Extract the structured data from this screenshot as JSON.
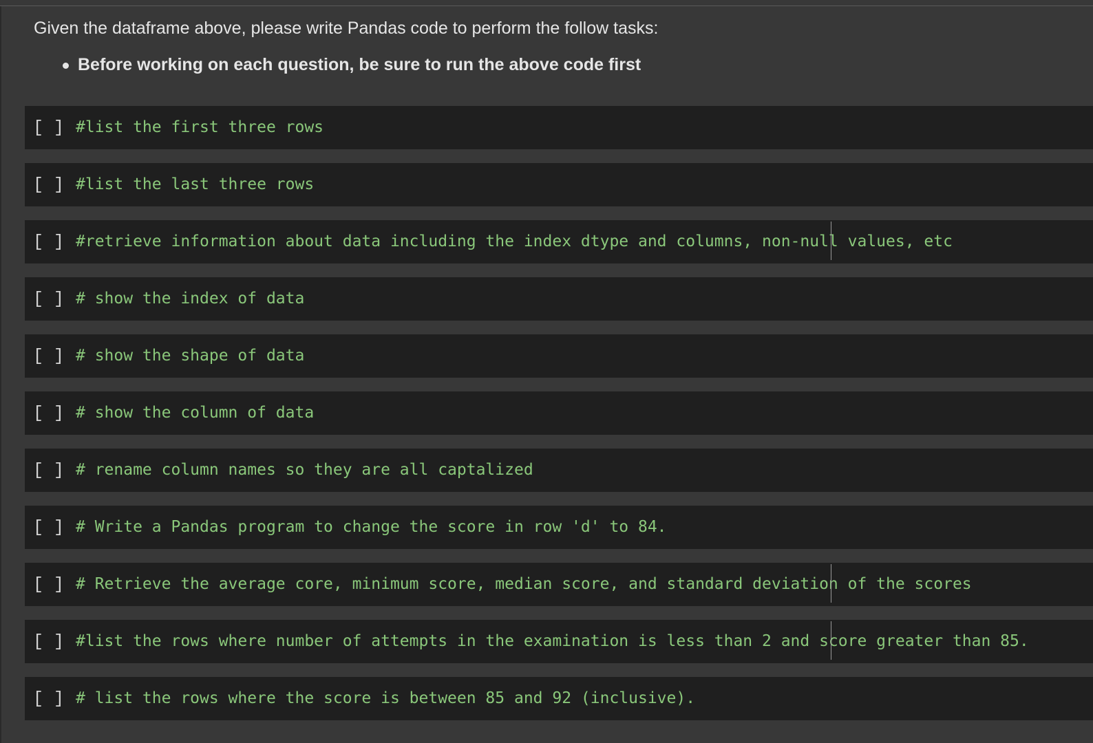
{
  "text_cell": {
    "intro": "Given the dataframe above, please write Pandas code to perform the follow tasks:",
    "bullets": [
      "Before working on each question, be sure to run the above code first"
    ]
  },
  "cells": [
    {
      "run_label": "[ ]",
      "code": "#list the first three rows"
    },
    {
      "run_label": "[ ]",
      "code": "#list the last three rows"
    },
    {
      "run_label": "[ ]",
      "code": "#retrieve information about data including the index dtype and columns, non-null values, etc"
    },
    {
      "run_label": "[ ]",
      "code": "# show the index of data"
    },
    {
      "run_label": "[ ]",
      "code": "# show the shape of data"
    },
    {
      "run_label": "[ ]",
      "code": "# show the column of data"
    },
    {
      "run_label": "[ ]",
      "code": "# rename column names so they are all captalized"
    },
    {
      "run_label": "[ ]",
      "code": "# Write a Pandas program to change the score in row 'd' to 84."
    },
    {
      "run_label": "[ ]",
      "code": "# Retrieve the average core, minimum score, median score, and standard deviation of the scores"
    },
    {
      "run_label": "[ ]",
      "code": "#list the rows where number of attempts in the examination is less than 2 and score greater than 85."
    },
    {
      "run_label": "[ ]",
      "code": "# list the rows where the score is between 85 and 92 (inclusive)."
    }
  ],
  "colors": {
    "background": "#383838",
    "cell_background": "#1f1f1f",
    "code_comment": "#8ac77a",
    "text": "#e6e6e6"
  }
}
